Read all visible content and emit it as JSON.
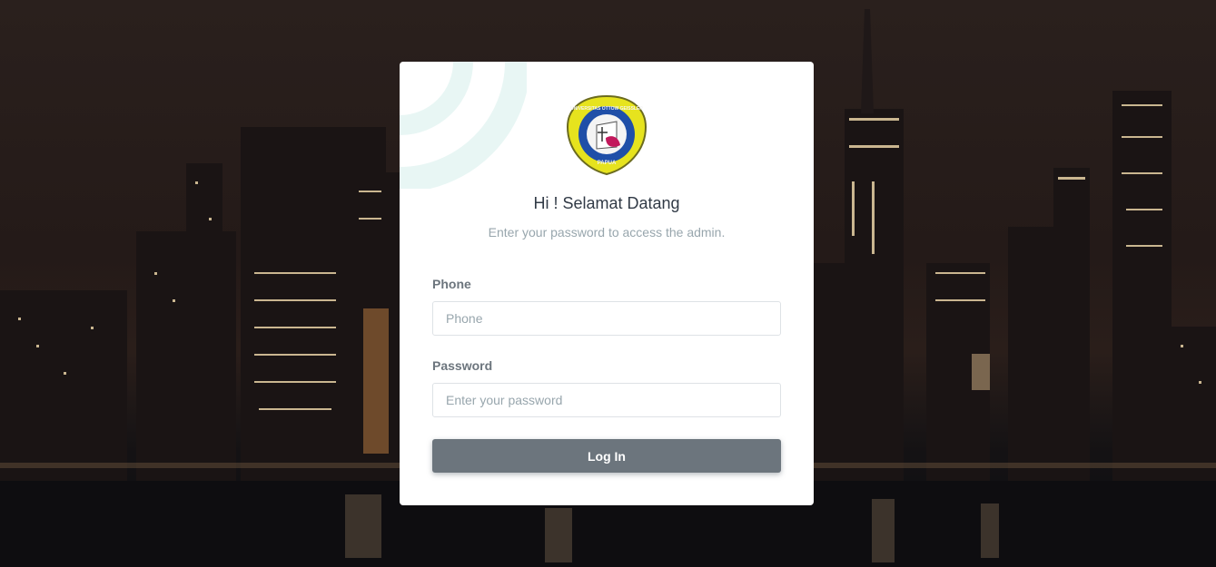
{
  "login": {
    "heading": "Hi ! Selamat Datang",
    "subheading": "Enter your password to access the admin.",
    "phone_label": "Phone",
    "phone_placeholder": "Phone",
    "phone_value": "",
    "password_label": "Password",
    "password_placeholder": "Enter your password",
    "password_value": "",
    "submit_label": "Log In"
  },
  "logo": {
    "top_text": "UNIVERSITAS OTTOW GEISSLER",
    "bottom_text": "PAPUA"
  },
  "colors": {
    "card_bg": "#ffffff",
    "button_bg": "#6c757d",
    "deco_arc": "#e8f6f4",
    "logo_yellow": "#e6e31e",
    "logo_blue": "#1f4fa8"
  }
}
